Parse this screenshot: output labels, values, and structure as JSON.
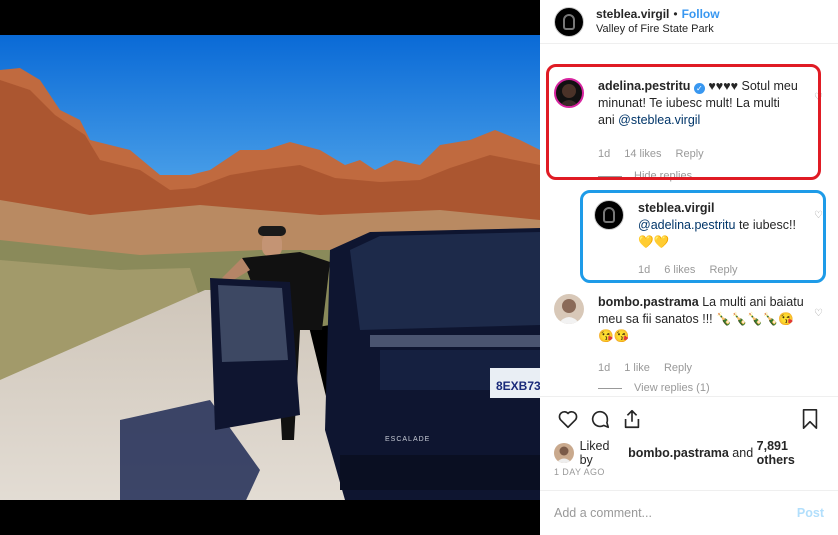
{
  "post": {
    "username": "steblea.virgil",
    "dot": "•",
    "follow_label": "Follow",
    "location": "Valley of Fire State Park"
  },
  "photo": {
    "plate_text": "8EXB73",
    "badge_text": "ESCALADE"
  },
  "comments": [
    {
      "username": "adelina.pestritu",
      "verified": true,
      "text": "♥♥♥♥ Sotul meu minunat! Te iubesc mult! La multi ani ",
      "mention": "@steblea.virgil",
      "age": "1d",
      "likes": "14 likes",
      "reply": "Reply",
      "toggle": "Hide replies"
    },
    {
      "username": "steblea.virgil",
      "mention": "@adelina.pestritu",
      "text": " te iubesc!!",
      "emoji": "💛💛",
      "age": "1d",
      "likes": "6 likes",
      "reply": "Reply"
    },
    {
      "username": "bombo.pastrama",
      "text": "La multi ani baiatu meu sa fii sanatos !!! 🍾🍾🍾🍾😘😘😘",
      "age": "1d",
      "likes": "1 like",
      "reply": "Reply",
      "toggle": "View replies (1)"
    }
  ],
  "likes_line": {
    "prefix": "Liked by ",
    "user": "bombo.pastrama",
    "middle": " and ",
    "others": "7,891 others"
  },
  "timestamp": "1 DAY AGO",
  "add_comment": {
    "placeholder": "Add a comment...",
    "post_label": "Post"
  },
  "colors": {
    "accent": "#3897f0",
    "highlight_red": "#e01b24",
    "highlight_blue": "#1e9be8"
  }
}
